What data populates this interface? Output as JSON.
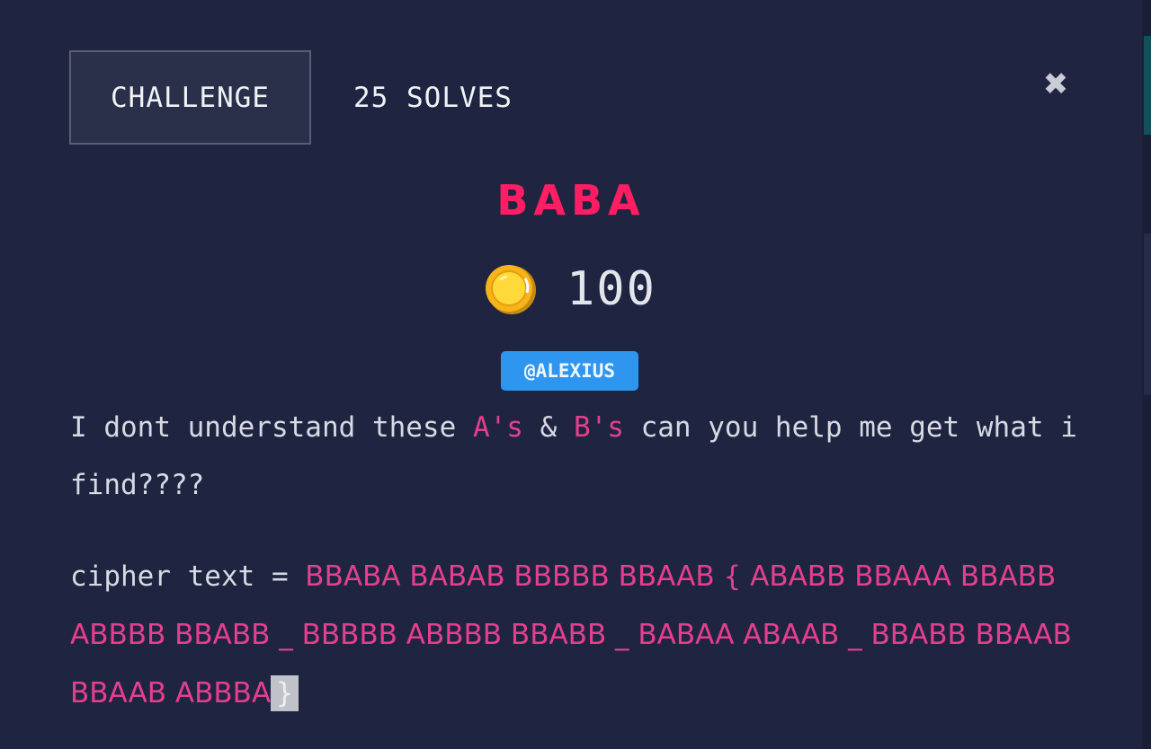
{
  "tabs": {
    "challenge_label": "CHALLENGE",
    "solves_label": "25 SOLVES"
  },
  "close_label": "✖",
  "challenge": {
    "name": "BABA",
    "points": "100",
    "author": "@ALEXIUS"
  },
  "description": {
    "part1": "I dont understand these ",
    "highlight_a": "A's",
    "amp": " & ",
    "highlight_b": "B's",
    "part2": " can you help me get what i find????"
  },
  "cipher": {
    "label": "cipher text = ",
    "value": "BBABA BABAB BBBBB BBAAB { ABABB BBAAA BBABB ABBBB BBABB _ BBBBB ABBBB BBABB _ BABAA ABAAB _ BBABB BBAAB BBAAB ABBBA",
    "closing": "}"
  },
  "colors": {
    "background": "#1f2540",
    "title": "#ff1e64",
    "highlight": "#e53f8e",
    "author_badge": "#2f96f0"
  },
  "icons": {
    "coin": "coin-icon",
    "close": "close-icon"
  }
}
